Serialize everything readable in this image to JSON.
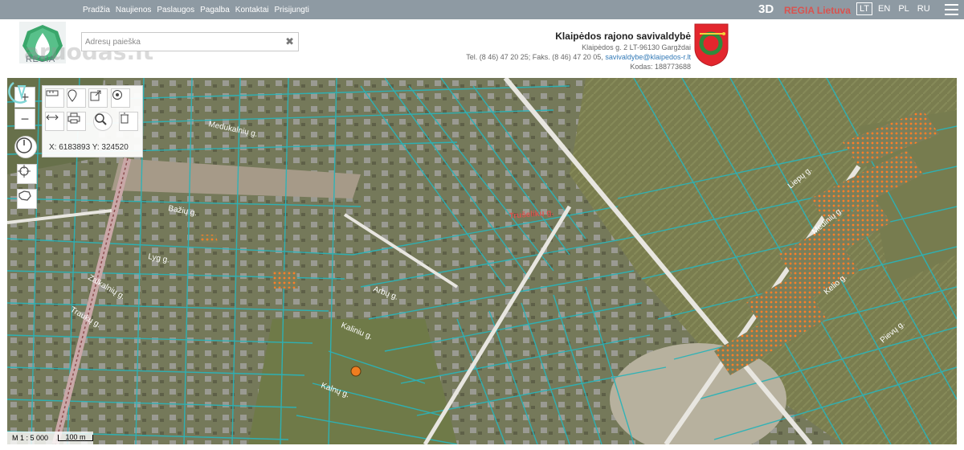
{
  "nav": {
    "items": [
      "Pradžia",
      "Naujienos",
      "Paslaugos",
      "Pagalba",
      "Kontaktai",
      "Prisijungti"
    ],
    "btn_3d": "3D",
    "regia_lietuva": "REGIA Lietuva",
    "languages": [
      "LT",
      "EN",
      "PL",
      "RU"
    ],
    "active_language": "LT"
  },
  "logo": {
    "text": "REGIA"
  },
  "watermark": "aruodas.lt",
  "search": {
    "placeholder": "Adresų paieška",
    "value": "",
    "clear_symbol": "✖"
  },
  "municipality": {
    "name": "Klaipėdos rajono savivaldybė",
    "address": "Klaipėdos g. 2 LT-96130 Gargždai",
    "tel": "Tel. (8 46) 47 20 25; Faks. (8 46) 47 20 05, ",
    "email": "savivaldybe@klaipedos-r.lt",
    "code": "Kodas: 188773688"
  },
  "map": {
    "coordinates": "X: 6183893 Y: 324520",
    "scale": "M 1 : 5 000",
    "scale_bar": "100 m",
    "street_labels": [
      "Medukalnių g.",
      "Arbų g.",
      "Bažių g.",
      "Kalnų g.",
      "Lyg g.",
      "Zalkalnių g.",
      "Traukų g.",
      "Kaliniu g.",
      "Trušelikų g.",
      "Liepų g.",
      "Medinių g.",
      "Kelio g.",
      "Pievų g."
    ],
    "colors": {
      "parcel": "#2bb3b8",
      "road": "#e8e6e0",
      "accent": "#ff7f27",
      "marker": "#f07d20"
    }
  }
}
